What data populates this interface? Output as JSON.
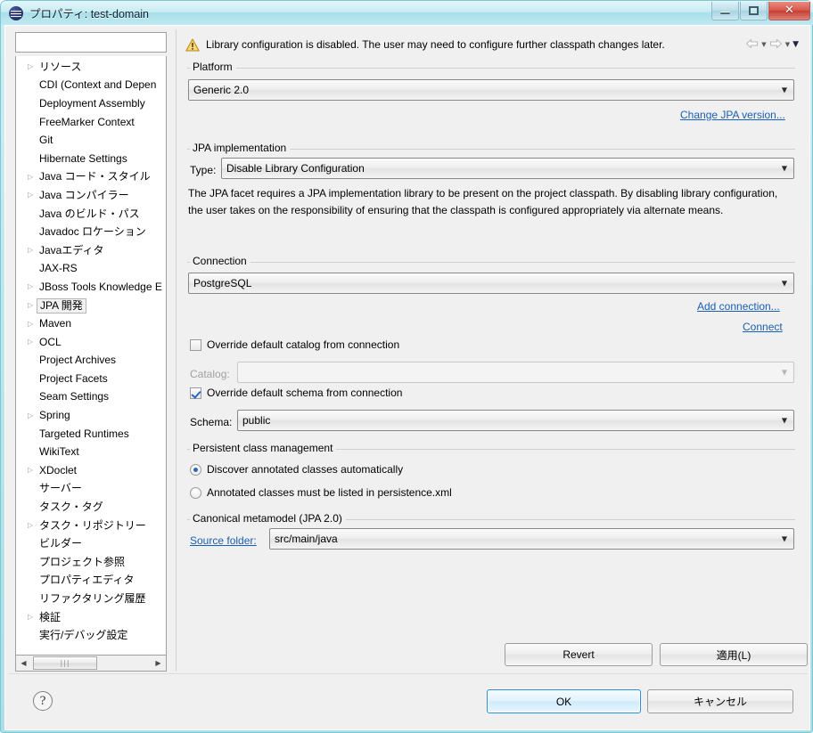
{
  "window": {
    "title": "プロパティ: test-domain",
    "icon": "properties-icon",
    "minimize_label": "",
    "maximize_label": "",
    "close_label": "✕"
  },
  "sidebar": {
    "filter_placeholder": "",
    "filter_value": "",
    "items": [
      {
        "label": "リソース",
        "expandable": true,
        "selected": false
      },
      {
        "label": "CDI (Context and Depen",
        "expandable": false,
        "selected": false
      },
      {
        "label": "Deployment Assembly",
        "expandable": false,
        "selected": false
      },
      {
        "label": "FreeMarker Context",
        "expandable": false,
        "selected": false
      },
      {
        "label": "Git",
        "expandable": false,
        "selected": false
      },
      {
        "label": "Hibernate Settings",
        "expandable": false,
        "selected": false
      },
      {
        "label": "Java コード・スタイル",
        "expandable": true,
        "selected": false
      },
      {
        "label": "Java コンパイラー",
        "expandable": true,
        "selected": false
      },
      {
        "label": "Java のビルド・パス",
        "expandable": false,
        "selected": false
      },
      {
        "label": "Javadoc ロケーション",
        "expandable": false,
        "selected": false
      },
      {
        "label": "Javaエディタ",
        "expandable": true,
        "selected": false
      },
      {
        "label": "JAX-RS",
        "expandable": false,
        "selected": false
      },
      {
        "label": "JBoss Tools Knowledge E",
        "expandable": true,
        "selected": false
      },
      {
        "label": "JPA 開発",
        "expandable": true,
        "selected": true
      },
      {
        "label": "Maven",
        "expandable": true,
        "selected": false
      },
      {
        "label": "OCL",
        "expandable": true,
        "selected": false
      },
      {
        "label": "Project Archives",
        "expandable": false,
        "selected": false
      },
      {
        "label": "Project Facets",
        "expandable": false,
        "selected": false
      },
      {
        "label": "Seam Settings",
        "expandable": false,
        "selected": false
      },
      {
        "label": "Spring",
        "expandable": true,
        "selected": false
      },
      {
        "label": "Targeted Runtimes",
        "expandable": false,
        "selected": false
      },
      {
        "label": "WikiText",
        "expandable": false,
        "selected": false
      },
      {
        "label": "XDoclet",
        "expandable": true,
        "selected": false
      },
      {
        "label": "サーバー",
        "expandable": false,
        "selected": false
      },
      {
        "label": "タスク・タグ",
        "expandable": false,
        "selected": false
      },
      {
        "label": "タスク・リポジトリー",
        "expandable": true,
        "selected": false
      },
      {
        "label": "ビルダー",
        "expandable": false,
        "selected": false
      },
      {
        "label": "プロジェクト参照",
        "expandable": false,
        "selected": false
      },
      {
        "label": "プロパティエディタ",
        "expandable": false,
        "selected": false
      },
      {
        "label": "リファクタリング履歴",
        "expandable": false,
        "selected": false
      },
      {
        "label": "検証",
        "expandable": true,
        "selected": false
      },
      {
        "label": "実行/デバッグ設定",
        "expandable": false,
        "selected": false
      }
    ],
    "hscroll": {
      "left_arrow": "◀",
      "right_arrow": "▶",
      "thumb_grip": "|||"
    }
  },
  "message_bar": {
    "icon": "warning-icon",
    "text": "Library configuration is disabled. The user may need to configure further classpath changes later.",
    "back_icon": "back-arrow-icon",
    "back_caret": "▼",
    "forward_icon": "forward-arrow-icon",
    "forward_caret": "▼",
    "menu_caret": "▼"
  },
  "platform": {
    "group_label": "Platform",
    "value": "Generic 2.0",
    "arrow": "▼",
    "change_link": "Change JPA version..."
  },
  "jpa_implementation": {
    "group_label": "JPA implementation",
    "type_label": "Type:",
    "type_value": "Disable Library Configuration",
    "arrow": "▼",
    "description": "The JPA facet requires a JPA implementation library to be present on the project classpath. By disabling library configuration, the user takes on the responsibility of ensuring that the classpath is configured appropriately via alternate means."
  },
  "connection": {
    "group_label": "Connection",
    "value": "PostgreSQL",
    "arrow": "▼",
    "add_link": "Add connection...",
    "connect_link": "Connect",
    "override_catalog_label": "Override default catalog from connection",
    "override_catalog_checked": false,
    "catalog_label": "Catalog:",
    "catalog_value": "",
    "catalog_arrow": "▼",
    "override_schema_label": "Override default schema from connection",
    "override_schema_checked": true,
    "schema_label": "Schema:",
    "schema_value": "public",
    "schema_arrow": "▼"
  },
  "persistent_class_management": {
    "group_label": "Persistent class management",
    "options": [
      {
        "label": "Discover annotated classes automatically",
        "selected": true
      },
      {
        "label": "Annotated classes must be listed in persistence.xml",
        "selected": false
      }
    ]
  },
  "canonical_metamodel": {
    "group_label": "Canonical metamodel (JPA 2.0)",
    "source_folder_link": "Source folder:",
    "source_folder_value": "src/main/java",
    "arrow": "▼"
  },
  "page_buttons": {
    "revert": "Revert",
    "apply": "適用(L)"
  },
  "dialog_buttons": {
    "help_icon": "?",
    "ok": "OK",
    "cancel": "キャンセル"
  }
}
